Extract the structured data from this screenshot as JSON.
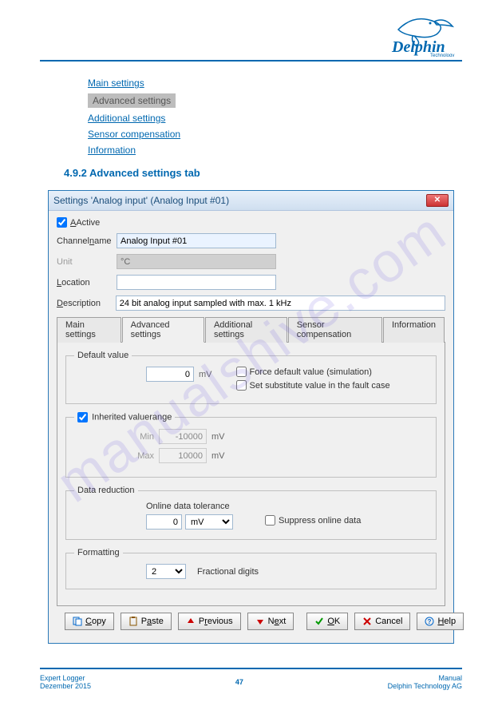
{
  "header": {
    "brand": "Delphin",
    "brand_sub": "Technology"
  },
  "toc": {
    "link1": "Main settings",
    "link2": "Additional settings",
    "link3": "Sensor compensation",
    "link4": "Information",
    "current": "Advanced settings"
  },
  "section_title": "4.9.2  Advanced settings tab",
  "dialog": {
    "title": "Settings 'Analog input' (Analog Input #01)",
    "active_label": "Active",
    "fields": {
      "channelname_label": "Channelname",
      "channelname_value": "Analog Input #01",
      "unit_label": "Unit",
      "unit_value": "°C",
      "location_label": "Location",
      "location_value": "",
      "description_label": "Description",
      "description_value": "24 bit analog input sampled with max. 1 kHz"
    },
    "tabs": {
      "main": "Main settings",
      "advanced": "Advanced settings",
      "additional": "Additional settings",
      "sensor": "Sensor compensation",
      "info": "Information"
    },
    "default_value": {
      "legend": "Default value",
      "value": "0",
      "unit": "mV",
      "force_label": "Force default value (simulation)",
      "substitute_label": "Set substitute value in the fault case"
    },
    "inherited": {
      "legend": "Inherited valuerange",
      "min_label": "Min",
      "min_value": "-10000",
      "max_label": "Max",
      "max_value": "10000",
      "unit": "mV"
    },
    "data_reduction": {
      "legend": "Data reduction",
      "tolerance_label": "Online data tolerance",
      "tolerance_value": "0",
      "tolerance_unit": "mV",
      "suppress_label": "Suppress online data"
    },
    "formatting": {
      "legend": "Formatting",
      "digits_value": "2",
      "digits_label": "Fractional digits"
    },
    "buttons": {
      "copy": "Copy",
      "paste": "Paste",
      "previous": "Previous",
      "next": "Next",
      "ok": "OK",
      "cancel": "Cancel",
      "help": "Help"
    }
  },
  "watermark": "manualshive.com",
  "footer": {
    "left": "Expert Logger",
    "page": "47",
    "right_l1": "Manual",
    "right_l2": "Delphin Technology AG",
    "left_date": "Dezember 2015"
  }
}
